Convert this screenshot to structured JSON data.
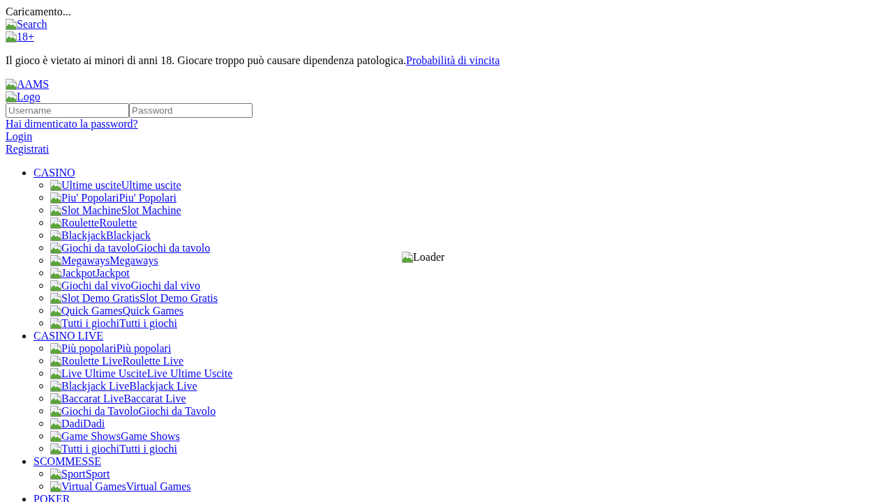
{
  "loading_text": "Caricamento...",
  "header": {
    "search_link": "Search",
    "age_link": "18+",
    "warning": {
      "text": "Il gioco è vietato ai minori di anni 18. Giocare troppo può causare dipendenza patologica.",
      "link": "Probabilità di vincita"
    },
    "aams_link": "AAMS",
    "logo_link": "Logo"
  },
  "login_form": {
    "username": {
      "placeholder": "Username"
    },
    "password": {
      "placeholder": "Password"
    },
    "forgot_link": "Hai dimenticato la password?",
    "login_link": "Login",
    "register_link": "Registrati"
  },
  "menu": [
    {
      "label": "CASINO",
      "children": [
        {
          "image_alt": "Ultime uscite",
          "label": "Ultime uscite"
        },
        {
          "image_alt": "Piu' Popolari",
          "label": "Piu' Popolari"
        },
        {
          "image_alt": "Slot Machine",
          "label": "Slot Machine"
        },
        {
          "image_alt": "Roulette",
          "label": "Roulette"
        },
        {
          "image_alt": "Blackjack",
          "label": "Blackjack"
        },
        {
          "image_alt": "Giochi da tavolo",
          "label": "Giochi da tavolo"
        },
        {
          "image_alt": "Megaways",
          "label": "Megaways"
        },
        {
          "image_alt": "Jackpot",
          "label": "Jackpot"
        },
        {
          "image_alt": "Giochi dal vivo",
          "label": "Giochi dal vivo"
        },
        {
          "image_alt": "Slot Demo Gratis",
          "label": "Slot Demo Gratis"
        },
        {
          "image_alt": "Quick Games",
          "label": "Quick Games"
        },
        {
          "image_alt": "Tutti i giochi",
          "label": "Tutti i giochi"
        }
      ]
    },
    {
      "label": "CASINO LIVE",
      "children": [
        {
          "image_alt": "Più popolari",
          "label": "Più popolari"
        },
        {
          "image_alt": "Roulette Live",
          "label": "Roulette Live"
        },
        {
          "image_alt": "Live Ultime Uscite",
          "label": "Live Ultime Uscite"
        },
        {
          "image_alt": "Blackjack Live",
          "label": "Blackjack Live"
        },
        {
          "image_alt": "Baccarat Live",
          "label": "Baccarat Live"
        },
        {
          "image_alt": "Giochi da Tavolo",
          "label": "Giochi da Tavolo"
        },
        {
          "image_alt": "Dadi",
          "label": "Dadi"
        },
        {
          "image_alt": "Game Shows",
          "label": "Game Shows"
        },
        {
          "image_alt": "Tutti i giochi",
          "label": "Tutti i giochi"
        }
      ]
    },
    {
      "label": "SCOMMESSE",
      "children": [
        {
          "image_alt": "Sport",
          "label": "Sport"
        },
        {
          "image_alt": "Virtual Games",
          "label": "Virtual Games"
        }
      ]
    },
    {
      "label": "POKER"
    }
  ],
  "loader": {
    "image_alt": "Loader"
  }
}
